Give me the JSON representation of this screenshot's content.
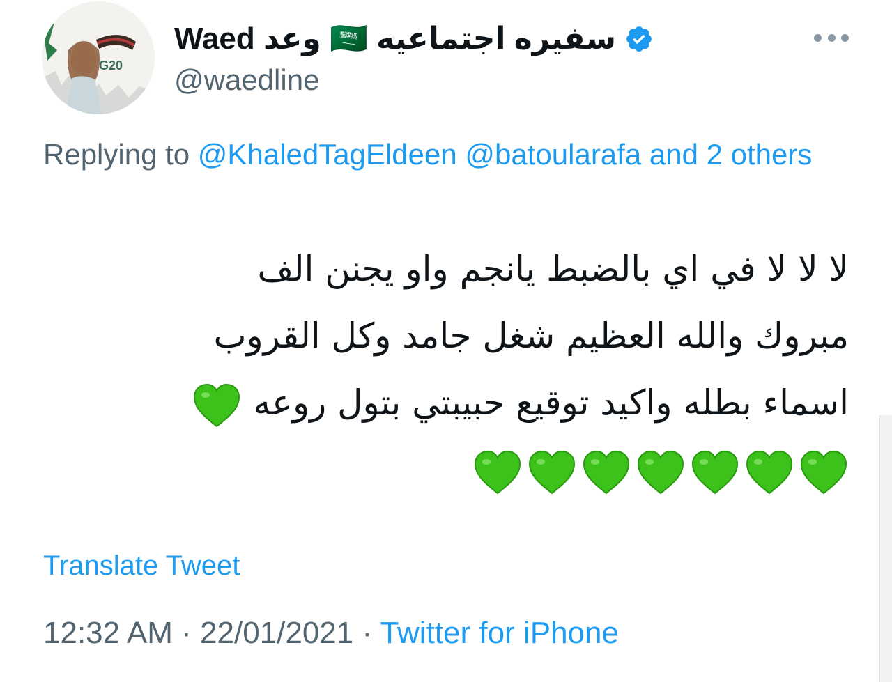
{
  "author": {
    "display_name": "Waed وعد 🇸🇦 سفيره اجتماعيه",
    "handle": "@waedline",
    "verified": true,
    "avatar_text": "G20"
  },
  "reply": {
    "prefix": "Replying to",
    "mention_1": "@KhaledTagEldeen",
    "mention_2": "@batoularafa",
    "others": "and 2 others"
  },
  "tweet": {
    "lines": [
      "لا لا لا في اي بالضبط يانجم واو يجنن الف",
      "مبروك والله العظيم شغل جامد وكل القروب",
      "اسماء بطله  واكيد توقيع حبيبتي بتول روعه"
    ],
    "heart_count_line3": 1,
    "heart_count_line4": 7
  },
  "translate_label": "Translate Tweet",
  "meta": {
    "time": "12:32 AM",
    "separator": "·",
    "date": "22/01/2021",
    "source": "Twitter for iPhone"
  },
  "colors": {
    "link": "#1d9bf0",
    "secondary": "#536471",
    "heart": "#3cc21b",
    "verified": "#1d9bf0"
  },
  "icons": [
    "verified-badge-icon",
    "more-options-icon",
    "green-heart-icon"
  ]
}
